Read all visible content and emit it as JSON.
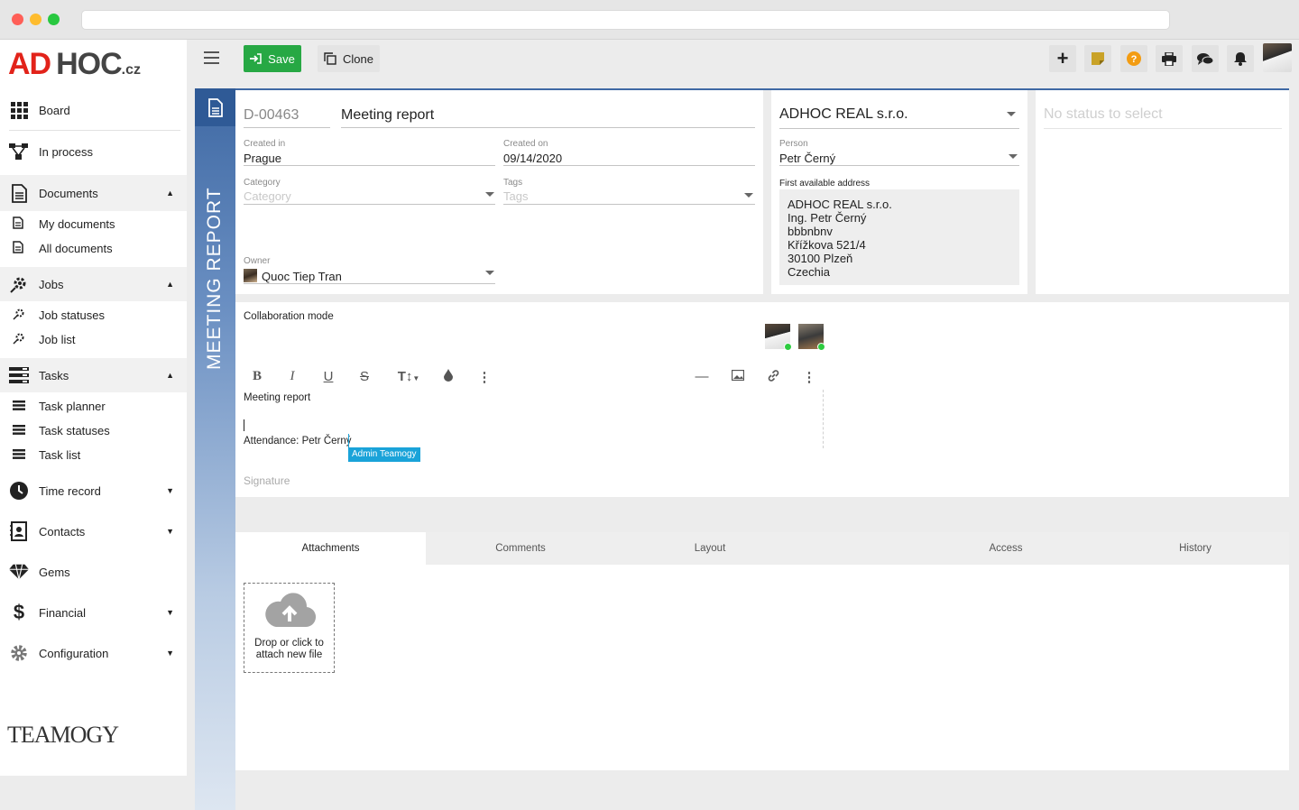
{
  "browser": {
    "dots": [
      "#ff5f57",
      "#febc2e",
      "#28c840"
    ]
  },
  "logo": {
    "ad": "AD",
    "hoc": "HOC",
    "cz": ".cz"
  },
  "sidebar": {
    "board": "Board",
    "in_process": "In process",
    "documents": "Documents",
    "my_documents": "My documents",
    "all_documents": "All documents",
    "jobs": "Jobs",
    "job_statuses": "Job statuses",
    "job_list": "Job list",
    "tasks": "Tasks",
    "task_planner": "Task planner",
    "task_statuses": "Task statuses",
    "task_list": "Task list",
    "time_record": "Time record",
    "contacts": "Contacts",
    "gems": "Gems",
    "financial": "Financial",
    "configuration": "Configuration",
    "footer_brand": "TEAMOGY"
  },
  "toolbar": {
    "save_label": "Save",
    "clone_label": "Clone"
  },
  "document": {
    "type_label": "MEETING REPORT",
    "number": "D-00463",
    "title": "Meeting report",
    "created_in_label": "Created in",
    "created_in": "Prague",
    "created_on_label": "Created on",
    "created_on": "09/14/2020",
    "category_label": "Category",
    "category_placeholder": "Category",
    "tags_label": "Tags",
    "tags_placeholder": "Tags",
    "owner_label": "Owner",
    "owner": "Quoc Tiep Tran"
  },
  "company": {
    "name": "ADHOC REAL s.r.o.",
    "person_label": "Person",
    "person": "Petr Černý",
    "address_label": "First available address",
    "address_lines": [
      "ADHOC REAL  s.r.o.",
      "Ing. Petr Černý",
      "bbbnbnv",
      "Křížkova 521/4",
      "30100 Plzeň",
      "Czechia"
    ]
  },
  "status": {
    "placeholder": "No status to select"
  },
  "collab": {
    "label": "Collaboration mode",
    "editor_line1": "Meeting report",
    "editor_line3": "Attendance: Petr Černý",
    "cursor_tag": "Admin Teamogy",
    "signature": "Signature"
  },
  "tabs": [
    "Attachments",
    "Comments",
    "Layout",
    "Access",
    "History"
  ],
  "attach": {
    "text": "Drop or click to attach new file"
  },
  "colors": {
    "accent": "#3f69a4",
    "save": "#27a844",
    "help": "#f39c12",
    "note": "#c9a227",
    "cursor_tag": "#1aa3d9"
  }
}
